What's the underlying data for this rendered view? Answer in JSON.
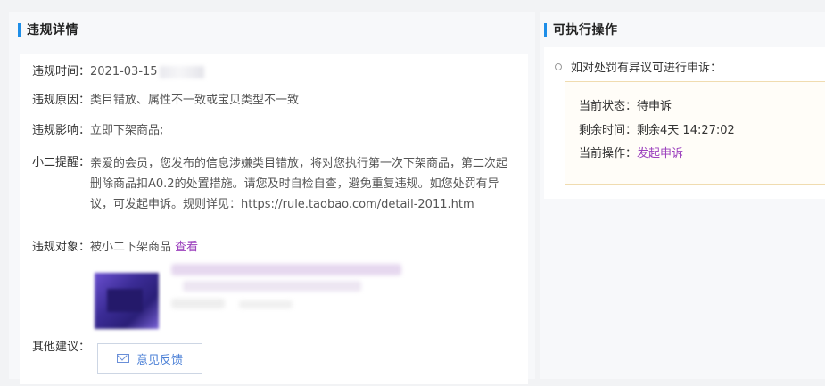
{
  "violation_panel": {
    "title": "违规详情",
    "time_label": "违规时间：",
    "time_value": "2021-03-15",
    "reason_label": "违规原因：",
    "reason_value": "类目错放、属性不一致或宝贝类型不一致",
    "impact_label": "违规影响：",
    "impact_value": "立即下架商品;",
    "tip_label": "小二提醒：",
    "tip_value": "亲爱的会员，您发布的信息涉嫌类目错放，将对您执行第一次下架商品，第二次起删除商品扣A0.2的处置措施。请您及时自检自查，避免重复违规。如您处罚有异议，可发起申诉。规则详见：https://rule.taobao.com/detail-2011.htm",
    "target_label": "违规对象：",
    "target_value": "被小二下架商品",
    "view_link": "查看",
    "other_label": "其他建议：",
    "feedback_button": "意见反馈"
  },
  "action_panel": {
    "title": "可执行操作",
    "hint": "如对处罚有异议可进行申诉：",
    "status_label": "当前状态：",
    "status_value": "待申诉",
    "remaining_label": "剩余时间：",
    "remaining_value": "剩余4天 14:27:02",
    "operation_label": "当前操作：",
    "operation_link": "发起申诉"
  },
  "colors": {
    "accent_bar": "#1e8ee8",
    "link": "#9b3fbd",
    "feedback_text": "#4a7fd6",
    "status_box_border": "#f0dcb0"
  }
}
